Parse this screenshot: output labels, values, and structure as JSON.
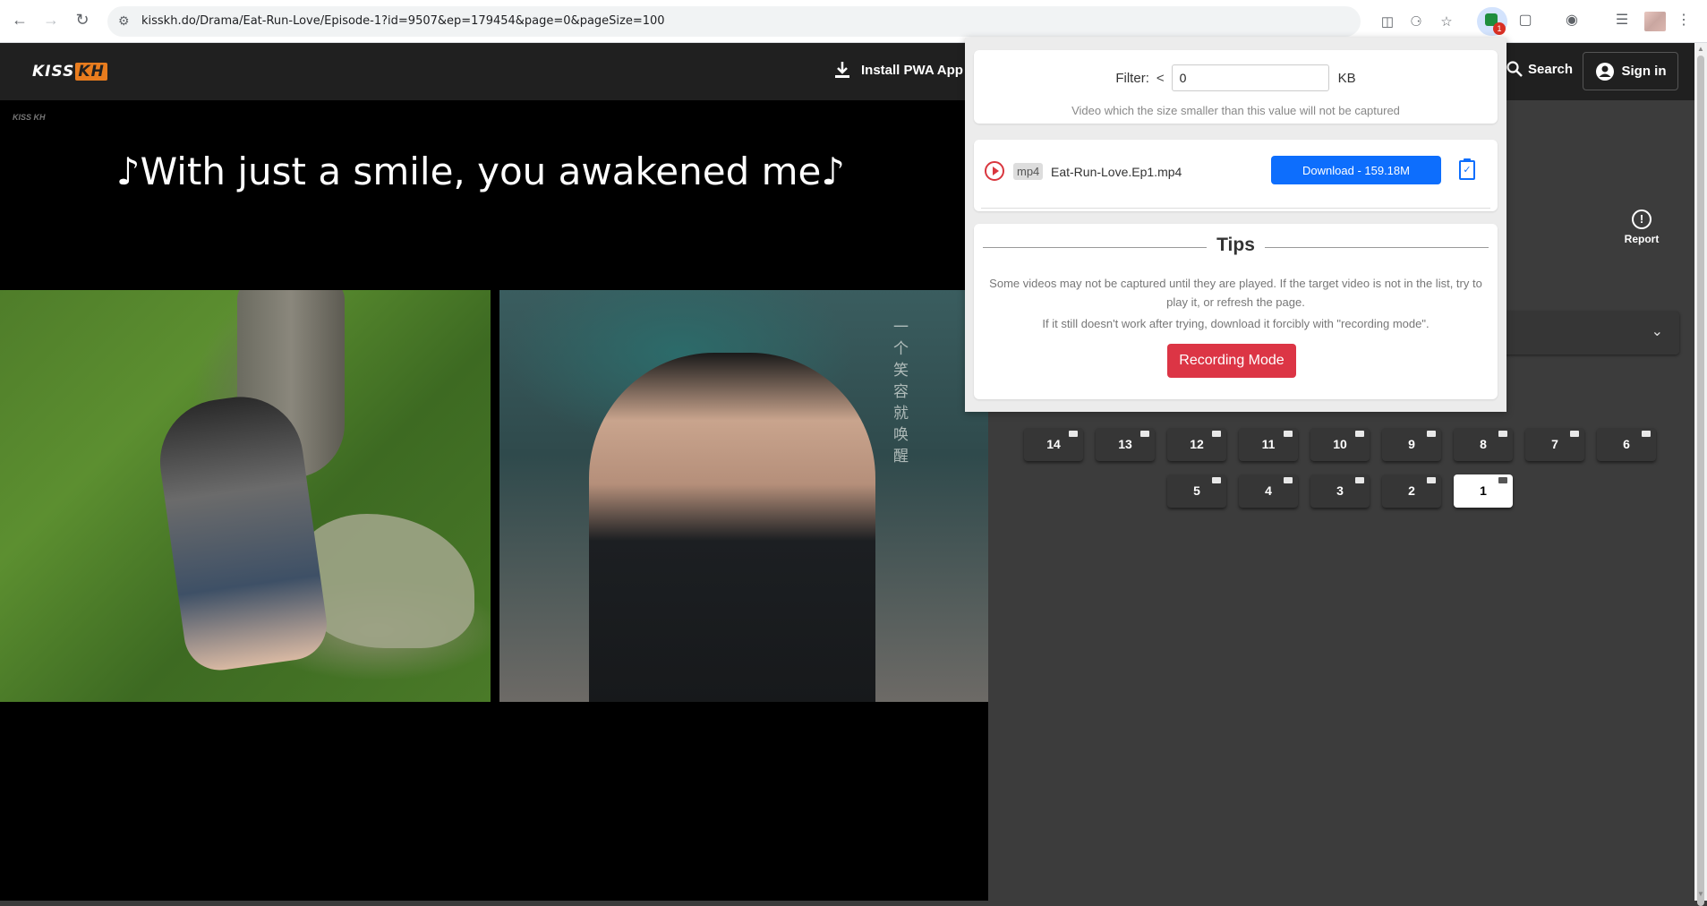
{
  "browser": {
    "url": "kisskh.do/Drama/Eat-Run-Love/Episode-1?id=9507&ep=179454&page=0&pageSize=100",
    "extension_badge": "1",
    "icons": [
      "back-icon",
      "forward-icon",
      "reload-icon",
      "site-info-icon",
      "install-icon",
      "translate-icon",
      "star-icon",
      "extension-icon",
      "puzzle-icon",
      "media-icon",
      "reading-list-icon",
      "menu-icon"
    ]
  },
  "header": {
    "logo_main": "KISS",
    "logo_accent": "KH",
    "install_label": "Install PWA App",
    "search_label": "Search",
    "signin_label": "Sign in"
  },
  "player": {
    "watermark": "KISS KH",
    "subtitle": "♪With just a smile, you awakened me♪",
    "frame_overlay_text": "一个笑容就唤醒"
  },
  "side": {
    "report_label": "Report",
    "episodes": [
      "14",
      "13",
      "12",
      "11",
      "10",
      "9",
      "8",
      "7",
      "6",
      "5",
      "4",
      "3",
      "2",
      "1"
    ],
    "active_episode": "1"
  },
  "popup": {
    "filter_label": "Filter:",
    "filter_operator": "<",
    "filter_value": "0",
    "filter_unit": "KB",
    "filter_hint": "Video which the size smaller than this value will not be captured",
    "video": {
      "format": "mp4",
      "filename": "Eat-Run-Love.Ep1.mp4",
      "download_label": "Download - 159.18M"
    },
    "tips_title": "Tips",
    "tips_line1": "Some videos may not be captured until they are played. If the target video is not in the list, try to play it, or refresh the page.",
    "tips_line2": "If it still doesn't work after trying, download it forcibly with \"recording mode\".",
    "recording_label": "Recording Mode"
  },
  "colors": {
    "download_button": "#0d6efd",
    "recording_button": "#dc3545",
    "site_header": "#202020",
    "logo_accent": "#e87c1e"
  }
}
